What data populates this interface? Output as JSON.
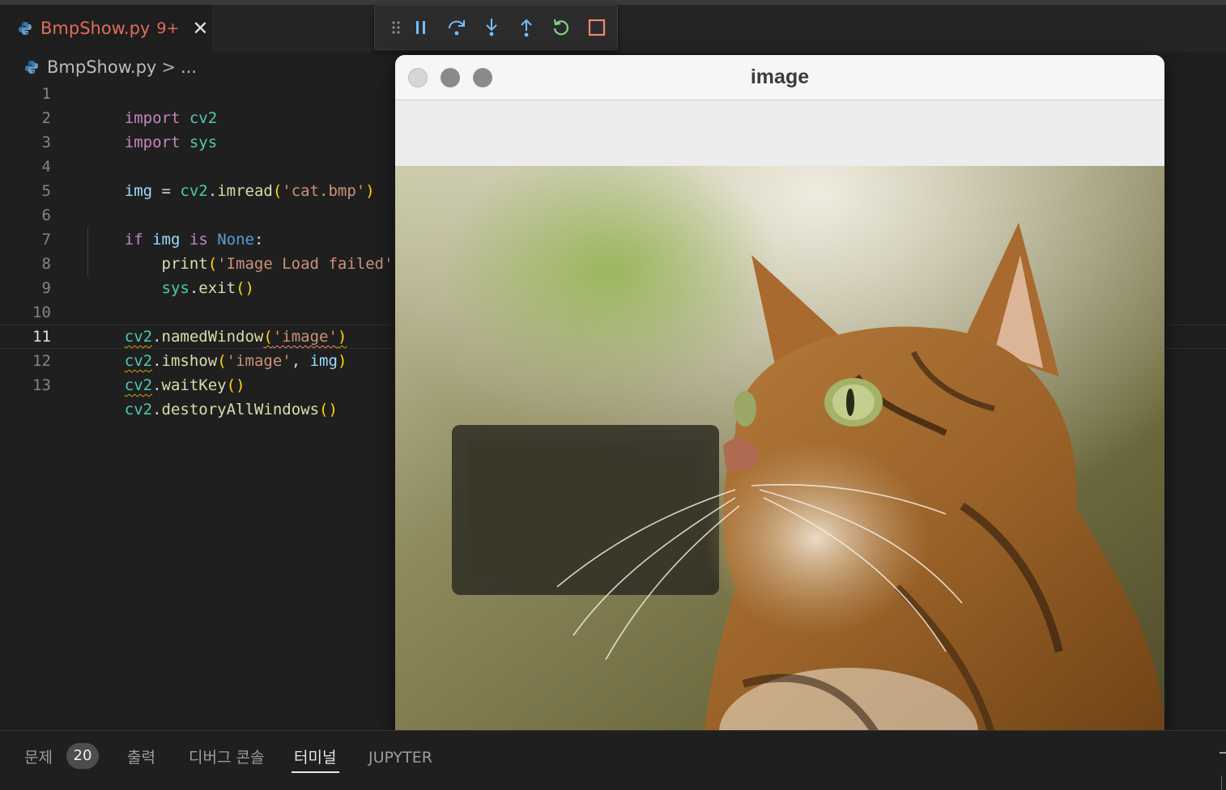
{
  "editor": {
    "tab": {
      "filename": "BmpShow.py",
      "problems_badge": "9+"
    },
    "breadcrumb": {
      "file": "BmpShow.py",
      "separator": ">",
      "more": "..."
    },
    "active_line": 11,
    "line_numbers": [
      "1",
      "2",
      "3",
      "4",
      "5",
      "6",
      "7",
      "8",
      "9",
      "10",
      "11",
      "12",
      "13"
    ],
    "code_lines": [
      "import cv2",
      "import sys",
      "",
      "img = cv2.imread('cat.bmp')",
      "",
      "if img is None:",
      "    print('Image Load failed')",
      "    sys.exit()",
      "",
      "cv2.namedWindow('image')",
      "cv2.imshow('image', img)",
      "cv2.waitKey()",
      "cv2.destoryAllWindows()"
    ]
  },
  "debug_toolbar": {
    "buttons": [
      "drag-handle",
      "pause",
      "step-over",
      "step-into",
      "step-out",
      "restart",
      "stop"
    ],
    "colors": {
      "pause": "#75beff",
      "step": "#75beff",
      "restart": "#89d185",
      "stop": "#f48771"
    }
  },
  "image_window": {
    "title": "image",
    "image_subject": "bengal cat looking up"
  },
  "panel": {
    "tabs": [
      {
        "label": "문제",
        "badge": "20"
      },
      {
        "label": "출력"
      },
      {
        "label": "디버그 콘솔"
      },
      {
        "label": "터미널",
        "active": true
      },
      {
        "label": "JUPYTER"
      }
    ]
  }
}
